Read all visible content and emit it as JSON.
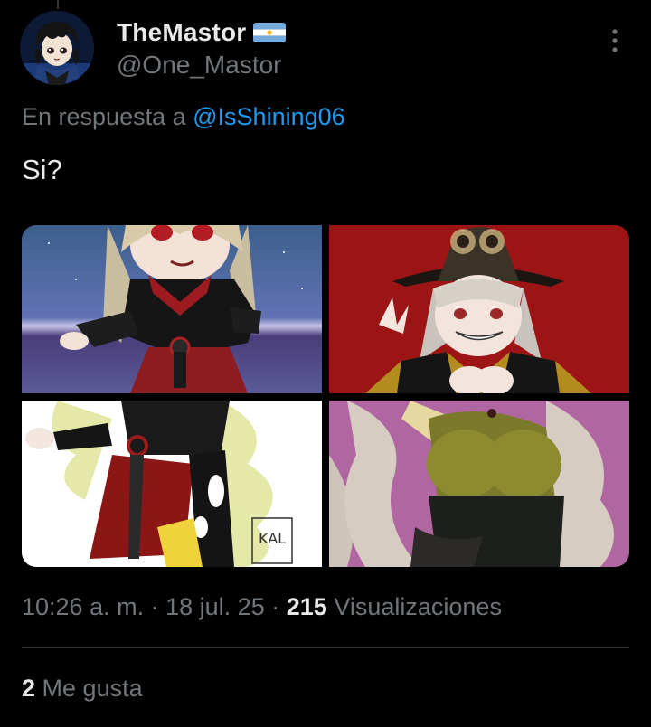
{
  "tweet": {
    "author": {
      "display_name": "TheMastor",
      "handle": "@One_Mastor",
      "flag_icon": "argentina-flag-icon",
      "avatar_icon": "anime-avatar-icon"
    },
    "reply": {
      "prefix": "En respuesta a",
      "mention": "@IsShining06"
    },
    "text": "Si?",
    "media": [
      {
        "name": "media-image-1",
        "description_icon": "gacha-character-image"
      },
      {
        "name": "media-image-2",
        "description_icon": "witch-character-image"
      },
      {
        "name": "media-image-3",
        "description_icon": "sketch-character-image"
      },
      {
        "name": "media-image-4",
        "description_icon": "closeup-character-image"
      }
    ],
    "meta": {
      "time": "10:26 a. m.",
      "separator": "·",
      "date": "18 jul. 25",
      "views_count": "215",
      "views_label": "Visualizaciones"
    },
    "likes": {
      "count": "2",
      "label": "Me gusta"
    },
    "more_icon": "more-options-icon"
  },
  "colors": {
    "background": "#000000",
    "primary_text": "#e7e9ea",
    "secondary_text": "#71767b",
    "link": "#1d9bf0",
    "divider": "#2f3336"
  }
}
